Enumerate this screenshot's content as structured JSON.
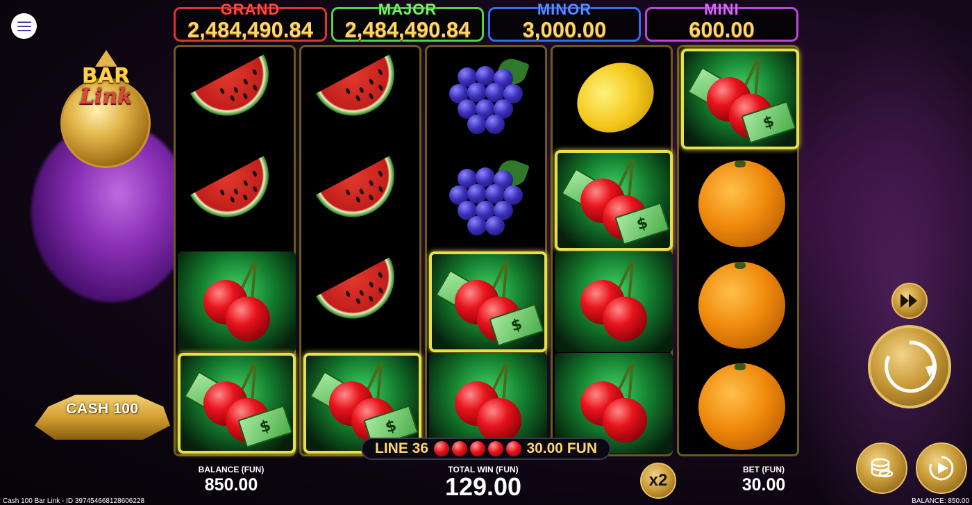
{
  "jackpots": {
    "grand": {
      "name": "GRAND",
      "value": "2,484,490.84"
    },
    "major": {
      "name": "MAJOR",
      "value": "2,484,490.84"
    },
    "minor": {
      "name": "MINOR",
      "value": "3,000.00"
    },
    "mini": {
      "name": "MINI",
      "value": "600.00"
    }
  },
  "logo": {
    "line1": "BAR",
    "line2": "Link"
  },
  "badge": {
    "label": "CASH 100"
  },
  "reels": [
    [
      "watermelon",
      "watermelon",
      "cherry",
      "cash-cherry"
    ],
    [
      "watermelon",
      "watermelon",
      "watermelon",
      "cash-cherry"
    ],
    [
      "grapes",
      "grapes",
      "cash-cherry",
      "cherry"
    ],
    [
      "lemon",
      "cash-cherry",
      "cherry",
      "cherry"
    ],
    [
      "cash-cherry",
      "orange",
      "orange",
      "orange"
    ]
  ],
  "line_win": {
    "line": "LINE 36",
    "symbol_count": 5,
    "amount": "30.00 FUN"
  },
  "balance": {
    "label": "BALANCE (FUN)",
    "value": "850.00"
  },
  "total_win": {
    "label": "TOTAL WIN (FUN)",
    "value": "129.00"
  },
  "bet": {
    "label": "BET (FUN)",
    "value": "30.00"
  },
  "multiplier": "x2",
  "footer": {
    "left": "Cash 100 Bar Link - ID 397454668128606228",
    "right": "BALANCE: 850.00"
  },
  "icons": {
    "menu": "hamburger-icon",
    "turbo": "fast-forward-icon",
    "spin": "spin-arrow-icon",
    "bet": "coin-stack-icon",
    "autoplay": "autoplay-icon"
  },
  "colors": {
    "grand": "#e03434",
    "major": "#54d24a",
    "minor": "#3a6cf0",
    "mini": "#b84ad8",
    "gold": "#ffd769"
  }
}
